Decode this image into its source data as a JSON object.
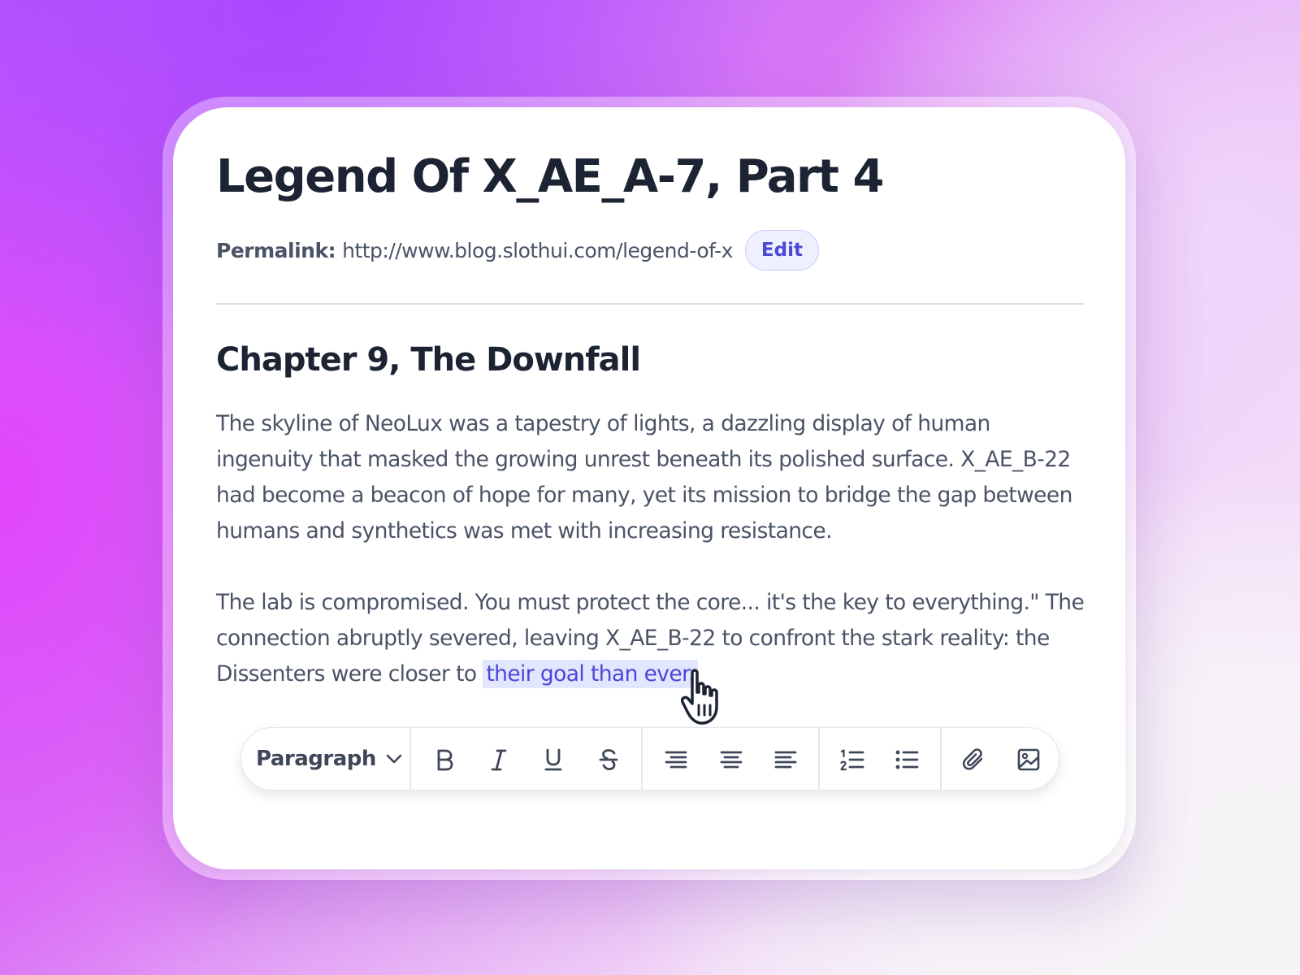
{
  "post": {
    "title": "Legend Of X_AE_A-7, Part 4",
    "permalink_label": "Permalink:",
    "permalink_url": "http://www.blog.slothui.com/legend-of-x",
    "edit_label": "Edit"
  },
  "content": {
    "heading": "Chapter 9, The Downfall",
    "paragraph1": "The skyline of NeoLux was a tapestry of lights, a dazzling display of human ingenuity that masked the growing unrest beneath its polished surface. X_AE_B-22 had become a beacon of hope for many, yet its mission to bridge the gap between humans and synthetics was met with increasing resistance.",
    "paragraph2_text": "The lab is compromised. You must protect the core... it's the key to everything.\" The connection abruptly severed, leaving X_AE_B-22 to confront the stark reality: the Dissenters were closer to ",
    "paragraph2_selected": "their goal than ever."
  },
  "toolbar": {
    "block_format": "Paragraph",
    "buttons": [
      {
        "name": "bold",
        "icon": "bold-icon"
      },
      {
        "name": "italic",
        "icon": "italic-icon"
      },
      {
        "name": "underline",
        "icon": "underline-icon"
      },
      {
        "name": "strikethrough",
        "icon": "strikethrough-icon"
      },
      {
        "name": "align-left",
        "icon": "align-left-icon"
      },
      {
        "name": "align-center",
        "icon": "align-center-icon"
      },
      {
        "name": "align-right",
        "icon": "align-right-icon"
      },
      {
        "name": "ordered-list",
        "icon": "ordered-list-icon"
      },
      {
        "name": "bullet-list",
        "icon": "bullet-list-icon"
      },
      {
        "name": "attach",
        "icon": "paperclip-icon"
      },
      {
        "name": "image",
        "icon": "image-icon"
      }
    ]
  },
  "colors": {
    "accent": "#4b48d6",
    "selection_bg": "#e3e6ff",
    "text_dark": "#1c2434",
    "text_body": "#4a5466"
  }
}
